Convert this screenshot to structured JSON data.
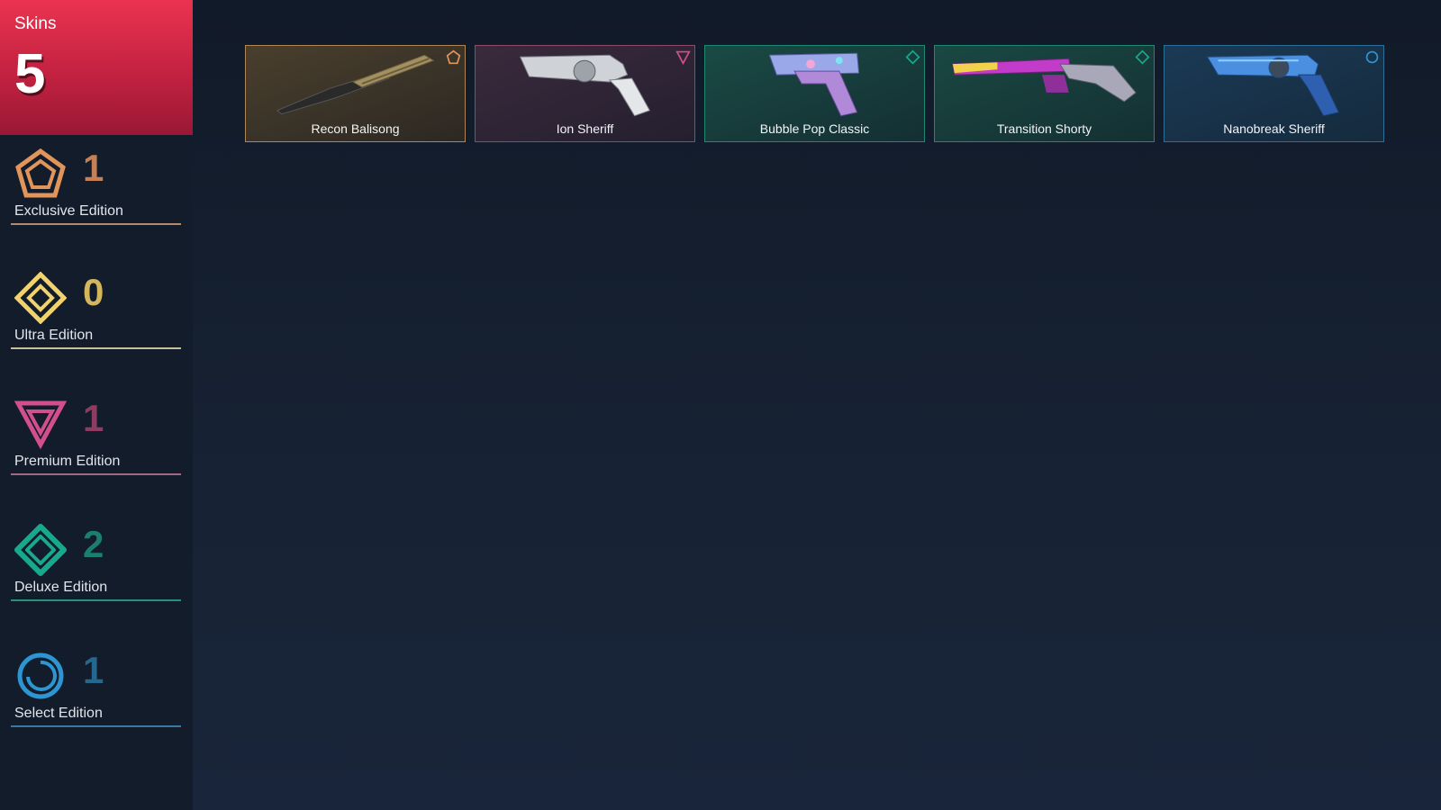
{
  "header": {
    "label": "Skins",
    "total": "5"
  },
  "tiers": [
    {
      "name": "Exclusive Edition",
      "count": "1",
      "icon": "exclusive-edition-icon",
      "color": "#e2955b",
      "count_color": "#c58056"
    },
    {
      "name": "Ultra Edition",
      "count": "0",
      "icon": "ultra-edition-icon",
      "color": "#f1d26c",
      "count_color": "#d4b65c"
    },
    {
      "name": "Premium Edition",
      "count": "1",
      "icon": "premium-edition-icon",
      "color": "#d14f8b",
      "count_color": "#8f3c62"
    },
    {
      "name": "Deluxe Edition",
      "count": "2",
      "icon": "deluxe-edition-icon",
      "color": "#18a98d",
      "count_color": "#1a7f6c"
    },
    {
      "name": "Select Edition",
      "count": "1",
      "icon": "select-edition-icon",
      "color": "#2e95d3",
      "count_color": "#25688f"
    }
  ],
  "skins": [
    {
      "name": "Recon Balisong",
      "tier": "exclusive",
      "border": "#b08656",
      "bg": "#3a3328",
      "icon": "knife-image"
    },
    {
      "name": "Ion Sheriff",
      "tier": "premium",
      "border": "#8d4a6a",
      "bg": "#2e2536",
      "icon": "revolver-image"
    },
    {
      "name": "Bubble Pop Classic",
      "tier": "deluxe",
      "border": "#1f8a74",
      "bg": "#153a38",
      "icon": "pistol-image"
    },
    {
      "name": "Transition Shorty",
      "tier": "deluxe",
      "border": "#1f8a74",
      "bg": "#163a37",
      "icon": "shotgun-image"
    },
    {
      "name": "Nanobreak Sheriff",
      "tier": "select",
      "border": "#2c6f9a",
      "bg": "#17324a",
      "icon": "revolver-image"
    }
  ]
}
